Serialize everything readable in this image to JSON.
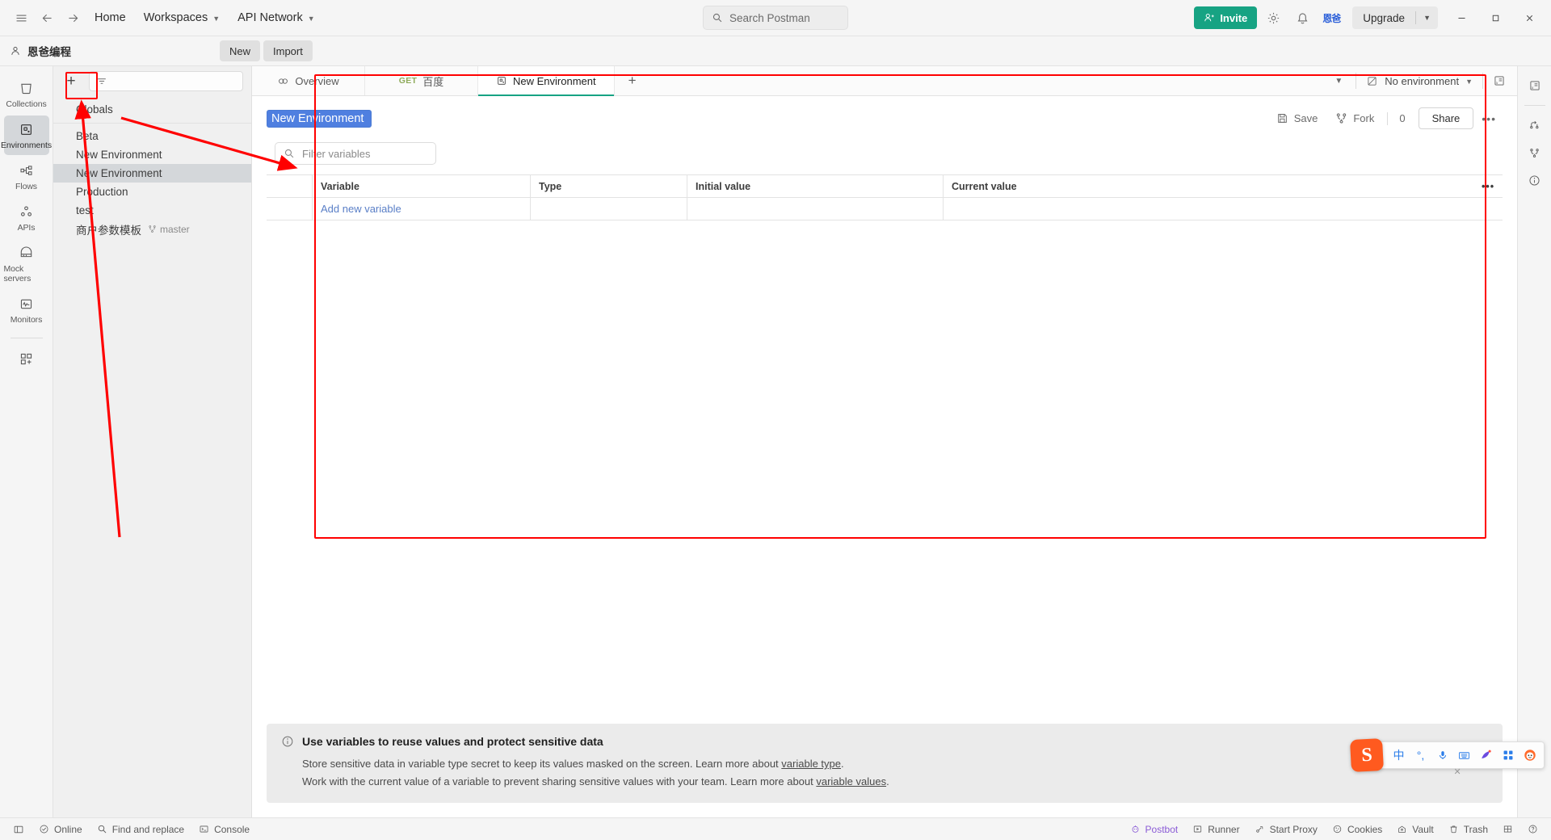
{
  "topbar": {
    "hamburger_icon": "hamburger-icon",
    "back_icon": "arrow-left-icon",
    "forward_icon": "arrow-right-icon",
    "nav": [
      {
        "label": "Home",
        "has_chevron": false
      },
      {
        "label": "Workspaces",
        "has_chevron": true
      },
      {
        "label": "API Network",
        "has_chevron": true
      }
    ],
    "search_placeholder": "Search Postman",
    "search_icon": "search-icon",
    "invite_label": "Invite",
    "invite_icon": "user-plus-icon",
    "settings_icon": "gear-icon",
    "notifications_icon": "bell-icon",
    "avatar_label": "恩爸",
    "upgrade_label": "Upgrade",
    "minimize_icon": "minimize-icon",
    "maximize_icon": "maximize-icon",
    "close_icon": "close-icon"
  },
  "workspacebar": {
    "user_icon": "person-icon",
    "workspace_name": "恩爸编程",
    "new_label": "New",
    "import_label": "Import"
  },
  "rail": {
    "items": [
      {
        "label": "Collections",
        "icon": "collections-icon",
        "active": false
      },
      {
        "label": "Environments",
        "icon": "environments-icon",
        "active": true
      },
      {
        "label": "Flows",
        "icon": "flows-icon",
        "active": false
      },
      {
        "label": "APIs",
        "icon": "apis-icon",
        "active": false
      },
      {
        "label": "Mock servers",
        "icon": "mock-servers-icon",
        "active": false
      },
      {
        "label": "Monitors",
        "icon": "monitors-icon",
        "active": false
      }
    ],
    "more_icon": "add-modules-icon"
  },
  "envpanel": {
    "create_icon": "plus-icon",
    "filter_icon": "filter-icon",
    "filter_placeholder": "",
    "globals_label": "Globals",
    "environments": [
      {
        "name": "Beta",
        "selected": false,
        "branch": ""
      },
      {
        "name": "New Environment",
        "selected": false,
        "branch": ""
      },
      {
        "name": "New Environment",
        "selected": true,
        "branch": ""
      },
      {
        "name": "Production",
        "selected": false,
        "branch": ""
      },
      {
        "name": "test",
        "selected": false,
        "branch": ""
      },
      {
        "name": "商户参数模板",
        "selected": false,
        "branch": "master"
      }
    ]
  },
  "tabs": {
    "items": [
      {
        "label": "Overview",
        "icon": "overview-icon",
        "method": "",
        "active": false
      },
      {
        "label": "百度",
        "icon": "",
        "method": "GET",
        "active": false
      },
      {
        "label": "New Environment",
        "icon": "environment-icon",
        "method": "",
        "active": true
      }
    ],
    "add_tab_icon": "plus-icon",
    "chevron_icon": "chevron-down-icon",
    "env_selector_label": "No environment",
    "env_selector_icon": "no-environment-icon",
    "env_quicklook_icon": "eye-variables-icon"
  },
  "editor": {
    "env_name_value": "New Environment",
    "save_label": "Save",
    "save_icon": "save-icon",
    "fork_label": "Fork",
    "fork_icon": "fork-icon",
    "fork_count": "0",
    "share_label": "Share",
    "more_icon": "more-horizontal-icon",
    "filter_placeholder": "Filter variables",
    "filter_icon": "search-icon",
    "table": {
      "columns": [
        "",
        "Variable",
        "Type",
        "Initial value",
        "Current value"
      ],
      "column_options_icon": "more-horizontal-icon",
      "rows": [
        {
          "variable": "Add new variable",
          "type": "",
          "initial_value": "",
          "current_value": ""
        }
      ]
    }
  },
  "banner": {
    "info_icon": "info-icon",
    "title": "Use variables to reuse values and protect sensitive data",
    "line1_prefix": "Store sensitive data in variable type secret to keep its values masked on the screen. Learn more about ",
    "line1_link": "variable type",
    "line1_suffix": ".",
    "line2_prefix": "Work with the current value of a variable to prevent sharing sensitive values with your team. Learn more about ",
    "line2_link": "variable values",
    "line2_suffix": ".",
    "close_icon": "close-icon"
  },
  "rightrail": {
    "items": [
      {
        "icon": "variables-sheet-icon"
      },
      {
        "icon": "comments-icon"
      },
      {
        "icon": "fork-tree-icon"
      },
      {
        "icon": "info-circle-icon"
      }
    ]
  },
  "statusbar": {
    "left": [
      {
        "label": "",
        "icon": "sidebar-toggle-icon"
      },
      {
        "label": "Online",
        "icon": "online-icon"
      },
      {
        "label": "Find and replace",
        "icon": "search-icon"
      },
      {
        "label": "Console",
        "icon": "console-icon"
      }
    ],
    "right": [
      {
        "label": "Postbot",
        "icon": "postbot-icon"
      },
      {
        "label": "Runner",
        "icon": "runner-icon"
      },
      {
        "label": "Start Proxy",
        "icon": "proxy-icon"
      },
      {
        "label": "Cookies",
        "icon": "cookies-icon"
      },
      {
        "label": "Vault",
        "icon": "vault-icon"
      },
      {
        "label": "Trash",
        "icon": "trash-icon"
      },
      {
        "label": "",
        "icon": "layout-icon"
      },
      {
        "label": "",
        "icon": "help-icon"
      }
    ]
  },
  "ime": {
    "logo_label": "S",
    "items": [
      {
        "label": "中",
        "icon": "chinese-mode-icon"
      },
      {
        "label": "°,",
        "icon": "punctuation-icon"
      },
      {
        "label": "",
        "icon": "microphone-icon"
      },
      {
        "label": "",
        "icon": "keyboard-icon"
      },
      {
        "label": "",
        "icon": "skin-icon"
      },
      {
        "label": "",
        "icon": "apps-grid-icon"
      },
      {
        "label": "",
        "icon": "mascot-icon"
      }
    ]
  },
  "annotations": {
    "highlight_boxes": [
      {
        "name": "create-environment-highlight"
      },
      {
        "name": "environment-editor-highlight"
      }
    ],
    "arrows": [
      {
        "name": "arrow-globals-to-right"
      },
      {
        "name": "arrow-up-to-plus"
      }
    ]
  }
}
